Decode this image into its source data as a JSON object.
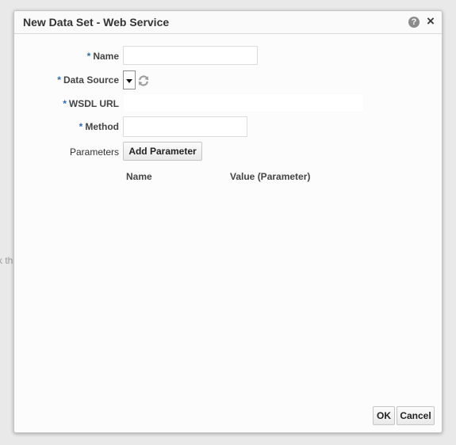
{
  "background": {
    "partial_text": "k th"
  },
  "dialog": {
    "title": "New Data Set - Web Service",
    "help_glyph": "?",
    "close_glyph": "×"
  },
  "form": {
    "required_marker": "*",
    "name": {
      "label": "Name",
      "value": ""
    },
    "data_source": {
      "label": "Data Source",
      "value": ""
    },
    "wsdl_url": {
      "label": "WSDL URL",
      "value": ""
    },
    "method": {
      "label": "Method",
      "value": ""
    },
    "parameters": {
      "label": "Parameters",
      "add_button_label": "Add Parameter"
    }
  },
  "parameters_table": {
    "columns": [
      "Name",
      "Value (Parameter)"
    ]
  },
  "footer": {
    "ok_label": "OK",
    "cancel_label": "Cancel"
  },
  "colors": {
    "required_marker": "#2a6db5",
    "dialog_background": "#fcfcfc",
    "help_icon": "#8c8c8c"
  },
  "icons": [
    "help-icon",
    "close-icon",
    "dropdown-arrow-icon",
    "refresh-icon"
  ]
}
